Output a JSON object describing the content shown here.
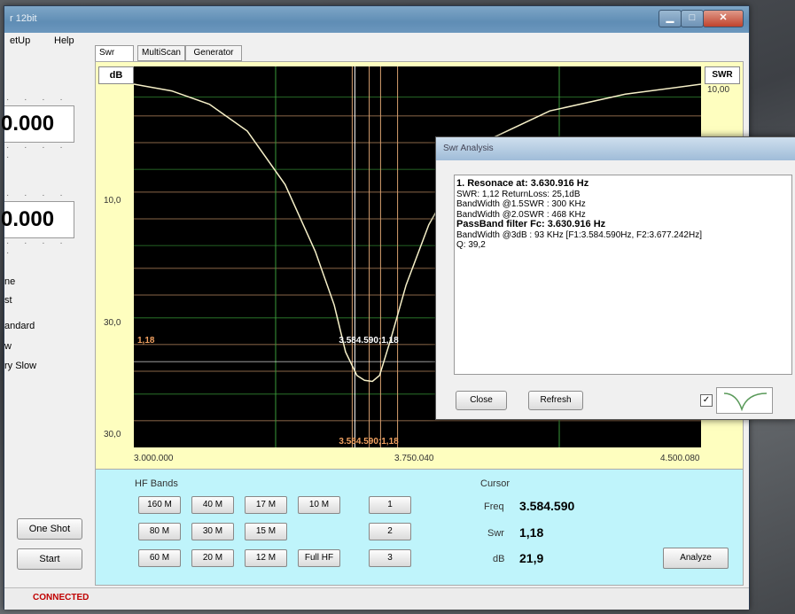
{
  "window": {
    "title": "r 12bit"
  },
  "menu": {
    "items": [
      "etUp",
      "Help"
    ]
  },
  "left_panel": {
    "freq_top": "0.000",
    "freq_bottom": "0.000",
    "dots": "· · · · ·",
    "speed_options": [
      "ne",
      "st",
      "andard",
      "w",
      "ry Slow"
    ],
    "one_shot_label": "One Shot",
    "start_label": "Start"
  },
  "tabs": [
    "Swr",
    "MultiScan",
    "Generator"
  ],
  "chart_header": {
    "left": "dB",
    "right": "SWR"
  },
  "chart_data": {
    "type": "line",
    "x_ticks": [
      "3.000.000",
      "3.750.040",
      "4.500.080"
    ],
    "y_ticks": [
      "10,0",
      "30,0",
      "30,0"
    ],
    "swr_tick": "10,00",
    "xlim": [
      3000000,
      4500080
    ],
    "swr_ylim": [
      1,
      10
    ],
    "series": [
      {
        "x": [
          3000000,
          3100000,
          3200000,
          3300000,
          3400000,
          3480000,
          3530000,
          3560000,
          3590000,
          3610000,
          3630916,
          3650000,
          3680000,
          3720000,
          3780000,
          3850000,
          3950000,
          4100000,
          4300000,
          4500080
        ],
        "y": [
          10,
          9.8,
          9.4,
          8.6,
          7.0,
          5.0,
          3.4,
          2.0,
          1.3,
          1.15,
          1.12,
          1.3,
          2.4,
          4.0,
          5.8,
          7.2,
          8.4,
          9.2,
          9.7,
          10
        ]
      }
    ],
    "cursor_label_swr": "3.584.590;1,18",
    "cursor_label_bottom": "3.584.590;1,18",
    "marker_left": "1,18",
    "colors": {
      "bg": "#000000",
      "curve": "#f6f0c8",
      "grid_green": "#3a9a3a",
      "grid_orange": "#d8a070"
    }
  },
  "hf_bands": {
    "title": "HF Bands",
    "rows": [
      [
        "160 M",
        "40 M",
        "17 M",
        "10 M"
      ],
      [
        "80 M",
        "30 M",
        "15 M"
      ],
      [
        "60 M",
        "20 M",
        "12 M",
        "Full HF"
      ]
    ],
    "nums": [
      "1",
      "2",
      "3"
    ]
  },
  "cursor": {
    "title": "Cursor",
    "freq_label": "Freq",
    "freq_value": "3.584.590",
    "swr_label": "Swr",
    "swr_value": "1,18",
    "db_label": "dB",
    "db_value": "21,9",
    "analyze_label": "Analyze"
  },
  "status": {
    "connected": "CONNECTED"
  },
  "dialog": {
    "title": "Swr Analysis",
    "lines": [
      {
        "text": "1. Resonace at: 3.630.916 Hz",
        "bold": true
      },
      {
        "text": "SWR: 1,12 ReturnLoss: 25,1dB",
        "bold": false
      },
      {
        "text": "BandWidth @1.5SWR : 300 KHz",
        "bold": false
      },
      {
        "text": "BandWidth @2.0SWR : 468 KHz",
        "bold": false
      },
      {
        "text": "PassBand filter Fc: 3.630.916 Hz",
        "bold": true
      },
      {
        "text": "BandWidth @3dB : 93 KHz [F1:3.584.590Hz, F2:3.677.242Hz]",
        "bold": false
      },
      {
        "text": "Q: 39,2",
        "bold": false
      }
    ],
    "close_label": "Close",
    "refresh_label": "Refresh"
  }
}
